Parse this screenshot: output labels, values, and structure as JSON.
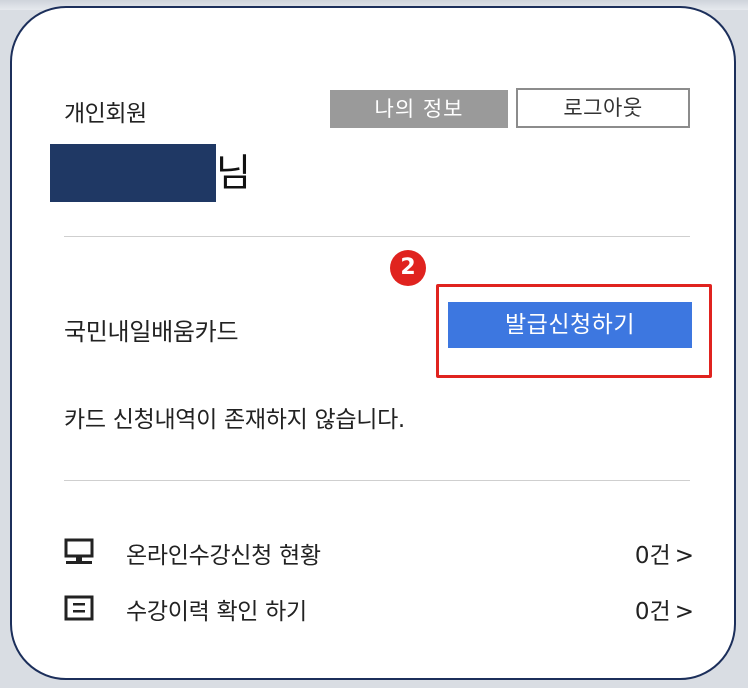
{
  "member": {
    "type_label": "개인회원",
    "my_info_label": "나의 정보",
    "logout_label": "로그아웃",
    "name_suffix": "님"
  },
  "card_section": {
    "label": "국민내일배움카드",
    "apply_label": "발급신청하기",
    "step_badge": "2",
    "status_text": "카드 신청내역이 존재하지 않습니다."
  },
  "list": [
    {
      "label": "온라인수강신청 현황",
      "count": "0건",
      "chevron": ">",
      "icon": "monitor-icon"
    },
    {
      "label": "수강이력 확인 하기",
      "count": "0건",
      "chevron": ">",
      "icon": "list-box-icon"
    }
  ],
  "colors": {
    "frame": "#1c2f5b",
    "redaction": "#1f3864",
    "apply_button": "#3d77e0",
    "highlight": "#e0231f",
    "my_info_button": "#9a9a9a"
  }
}
